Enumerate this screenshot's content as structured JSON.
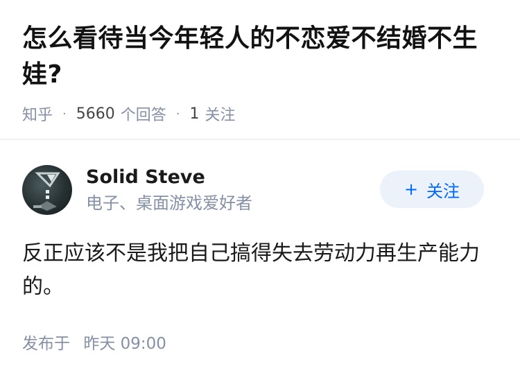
{
  "question": {
    "title": "怎么看待当今年轻人的不恋爱不结婚不生娃?",
    "source": "知乎",
    "separator": "·",
    "answer_count": "5660",
    "answer_label": "个回答",
    "follow_count": "1",
    "follow_label": "关注"
  },
  "answer": {
    "author_name": "Solid Steve",
    "author_bio": "电子、桌面游戏爱好者",
    "follow_button": {
      "icon": "+",
      "label": "关注"
    },
    "content": "反正应该不是我把自己搞得失去劳动力再生产能力的。",
    "published_label": "发布于",
    "published_time": "昨天 09:00"
  },
  "colors": {
    "meta_gray": "#8590a6",
    "accent_blue": "#0066ff",
    "button_bg": "#ebf2fa",
    "divider": "#f0f2f5"
  }
}
